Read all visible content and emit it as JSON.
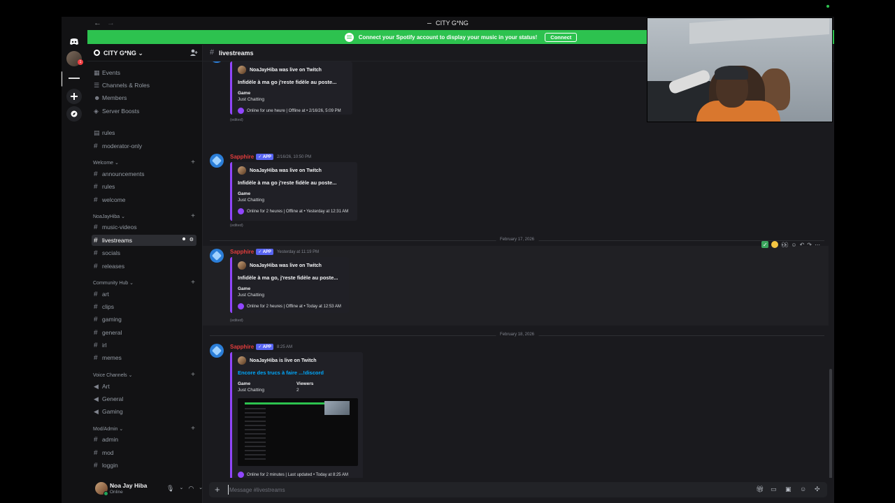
{
  "window": {
    "title": "CITY G*NG"
  },
  "banner": {
    "text": "Connect your Spotify account to display your music in your status!",
    "button": "Connect",
    "color": "#2dc24f"
  },
  "server": {
    "name": "CITY G*NG"
  },
  "sidebar": {
    "top_items": [
      {
        "label": "Events",
        "icon": "calendar-icon"
      },
      {
        "label": "Channels & Roles",
        "icon": "list-icon"
      },
      {
        "label": "Members",
        "icon": "members-icon"
      },
      {
        "label": "Server Boosts",
        "icon": "boost-icon"
      }
    ],
    "ungrouped": [
      "rules",
      "moderator-only"
    ],
    "categories": [
      {
        "name": "Welcome",
        "channels": [
          "announcements",
          "rules",
          "welcome"
        ]
      },
      {
        "name": "NoaJayHiba",
        "channels": [
          "music-videos",
          "livestreams",
          "socials",
          "releases"
        ]
      },
      {
        "name": "Community Hub",
        "channels": [
          "art",
          "clips",
          "gaming",
          "general",
          "irl",
          "memes"
        ]
      },
      {
        "name": "Voice Channels",
        "channels": [
          "Art",
          "General",
          "Gaming"
        ]
      },
      {
        "name": "Mod/Admin",
        "channels": [
          "admin",
          "mod",
          "loggin"
        ]
      }
    ],
    "active_channel": "livestreams"
  },
  "user": {
    "name": "Noa Jay Hiba",
    "status": "Online"
  },
  "channel": {
    "name": "livestreams"
  },
  "messages": [
    {
      "author": "",
      "badge": "",
      "time": "",
      "embed": {
        "author": "NoaJayHiba was live on Twitch",
        "title": "Infidèle à ma go j'reste fidèle au poste...",
        "field1_name": "Game",
        "field1_value": "Just Chatting",
        "footer": "Online for une heure | Offline at • 2/16/26, 5:09 PM"
      },
      "edited": "(edited)"
    },
    {
      "author": "Sapphire",
      "badge": "✓ APP",
      "time": "2/16/26, 10:50 PM",
      "embed": {
        "author": "NoaJayHiba was live on Twitch",
        "title": "Infidèle à ma go j'reste fidèle au poste...",
        "field1_name": "Game",
        "field1_value": "Just Chatting",
        "footer": "Online for 2 heures | Offline at • Yesterday at 12:31 AM"
      },
      "edited": "(edited)"
    },
    {
      "author": "Sapphire",
      "badge": "✓ APP",
      "time": "Yesterday at 11:19 PM",
      "embed": {
        "author": "NoaJayHiba was live on Twitch",
        "title": "Infidèle à ma go, j'reste fidèle au poste...",
        "field1_name": "Game",
        "field1_value": "Just Chatting",
        "footer": "Online for 2 heures | Offline at • Today at 12:53 AM"
      },
      "edited": "(edited)"
    },
    {
      "author": "Sapphire",
      "badge": "✓ APP",
      "time": "8:25 AM",
      "embed": {
        "author": "NoaJayHiba is live on Twitch",
        "title": "Encore des trucs à faire ...!discord",
        "field1_name": "Game",
        "field1_value": "Just Chatting",
        "field2_name": "Viewers",
        "field2_value": "2",
        "footer": "Online for 2 minutes | Last updated • Today at 8:25 AM"
      }
    }
  ],
  "dividers": [
    "February 17, 2026",
    "February 18, 2026"
  ],
  "composer": {
    "placeholder": "Message #livestreams"
  },
  "colors": {
    "twitch": "#9146ff",
    "author": "#e23d3d",
    "app_badge": "#5865f2",
    "link": "#00a8fc"
  }
}
